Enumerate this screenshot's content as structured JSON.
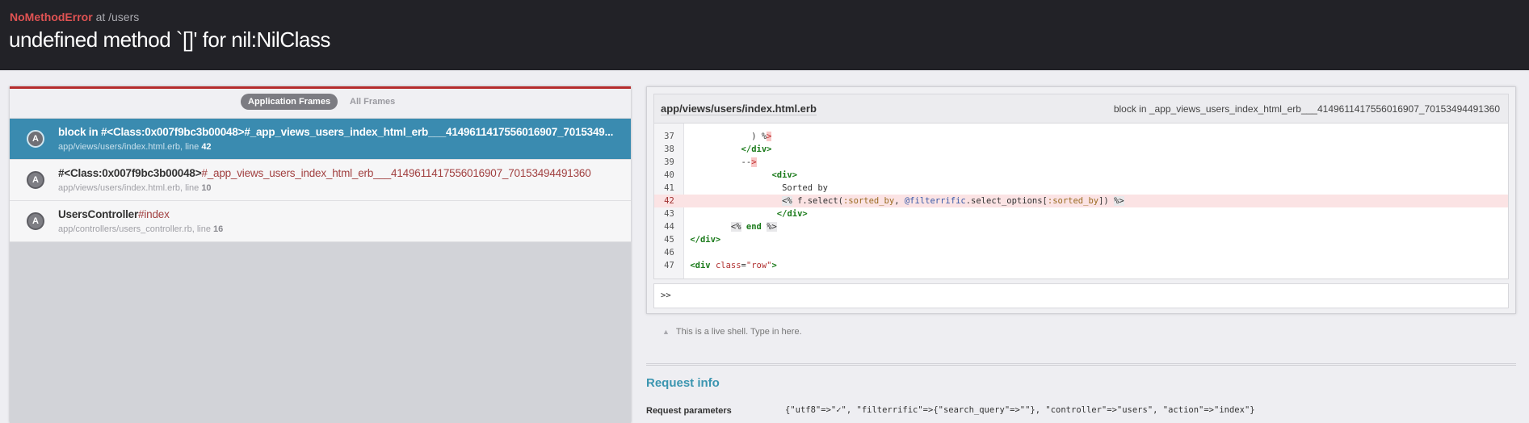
{
  "header": {
    "exception_name": "NoMethodError",
    "exception_location": "at /users",
    "message": "undefined method `[]' for nil:NilClass"
  },
  "frames_panel": {
    "tabs": [
      {
        "label": "Application Frames",
        "active": true
      },
      {
        "label": "All Frames",
        "active": false
      }
    ],
    "frames": [
      {
        "badge": "A",
        "name_bold": "block in #<Class:0x007f9bc3b00048>",
        "name_rest": "#_app_views_users_index_html_erb___4149611417556016907_7015349...",
        "file": "app/views/users/index.html.erb",
        "line_label": ", line ",
        "line": "42",
        "selected": true
      },
      {
        "badge": "A",
        "name_bold": "#<Class:0x007f9bc3b00048>",
        "name_rest": "#_app_views_users_index_html_erb___4149611417556016907_70153494491360",
        "file": "app/views/users/index.html.erb",
        "line_label": ", line ",
        "line": "10",
        "selected": false
      },
      {
        "badge": "A",
        "name_bold": "UsersController",
        "name_rest": "#index",
        "file": "app/controllers/users_controller.rb",
        "line_label": ", line ",
        "line": "16",
        "selected": false
      }
    ]
  },
  "code": {
    "file": "app/views/users/index.html.erb",
    "method": "block in _app_views_users_index_html_erb___4149611417556016907_70153494491360",
    "highlighted_line": "42",
    "lines": [
      {
        "n": "37",
        "indent": "            ",
        "parts": [
          {
            "text": ") %",
            "cls": ""
          },
          {
            "text": ">",
            "cls": "er"
          }
        ]
      },
      {
        "n": "38",
        "indent": "          ",
        "parts": [
          {
            "text": "</div>",
            "cls": "t"
          }
        ]
      },
      {
        "n": "39",
        "indent": "          ",
        "parts": [
          {
            "text": "--",
            "cls": ""
          },
          {
            "text": ">",
            "cls": "er"
          }
        ]
      },
      {
        "n": "40",
        "indent": "                ",
        "parts": [
          {
            "text": "<div>",
            "cls": "t"
          }
        ]
      },
      {
        "n": "41",
        "indent": "                  ",
        "parts": [
          {
            "text": "Sorted by",
            "cls": ""
          }
        ]
      },
      {
        "n": "42",
        "indent": "                  ",
        "parts": [
          {
            "text": "<%",
            "cls": "e"
          },
          {
            "text": " f.select(",
            "cls": ""
          },
          {
            "text": ":sorted_by",
            "cls": "sym"
          },
          {
            "text": ", ",
            "cls": ""
          },
          {
            "text": "@filterrific",
            "cls": "ivar"
          },
          {
            "text": ".select_options[",
            "cls": ""
          },
          {
            "text": ":sorted_by",
            "cls": "sym"
          },
          {
            "text": "]) ",
            "cls": ""
          },
          {
            "text": "%>",
            "cls": "e"
          }
        ]
      },
      {
        "n": "43",
        "indent": "                 ",
        "parts": [
          {
            "text": "</div>",
            "cls": "t"
          }
        ]
      },
      {
        "n": "44",
        "indent": "        ",
        "parts": [
          {
            "text": "<%",
            "cls": "e"
          },
          {
            "text": " ",
            "cls": ""
          },
          {
            "text": "end",
            "cls": "kw"
          },
          {
            "text": " ",
            "cls": ""
          },
          {
            "text": "%>",
            "cls": "e"
          }
        ]
      },
      {
        "n": "45",
        "indent": "",
        "parts": [
          {
            "text": "</div>",
            "cls": "t"
          }
        ]
      },
      {
        "n": "46",
        "indent": "",
        "parts": []
      },
      {
        "n": "47",
        "indent": "",
        "parts": [
          {
            "text": "<div ",
            "cls": "t"
          },
          {
            "text": "class",
            "cls": "attr"
          },
          {
            "text": "=",
            "cls": ""
          },
          {
            "text": "\"row\"",
            "cls": "str"
          },
          {
            "text": ">",
            "cls": "t"
          }
        ]
      }
    ],
    "shell_prompt": ">>"
  },
  "hint": {
    "icon": "triangle-up-icon",
    "text": "This is a live shell. Type in here."
  },
  "request_info": {
    "title": "Request info",
    "params_label": "Request parameters",
    "params_value": "{\"utf8\"=>\"✓\", \"filterrific\"=>{\"search_query\"=>\"\"}, \"controller\"=>\"users\", \"action\"=>\"index\"}"
  },
  "colors": {
    "header_bg": "#222227",
    "exception_red": "#e05353",
    "selected_frame": "#3a8bb0",
    "accent_teal": "#3b95b0",
    "highlight_line": "#fbe3e4"
  }
}
